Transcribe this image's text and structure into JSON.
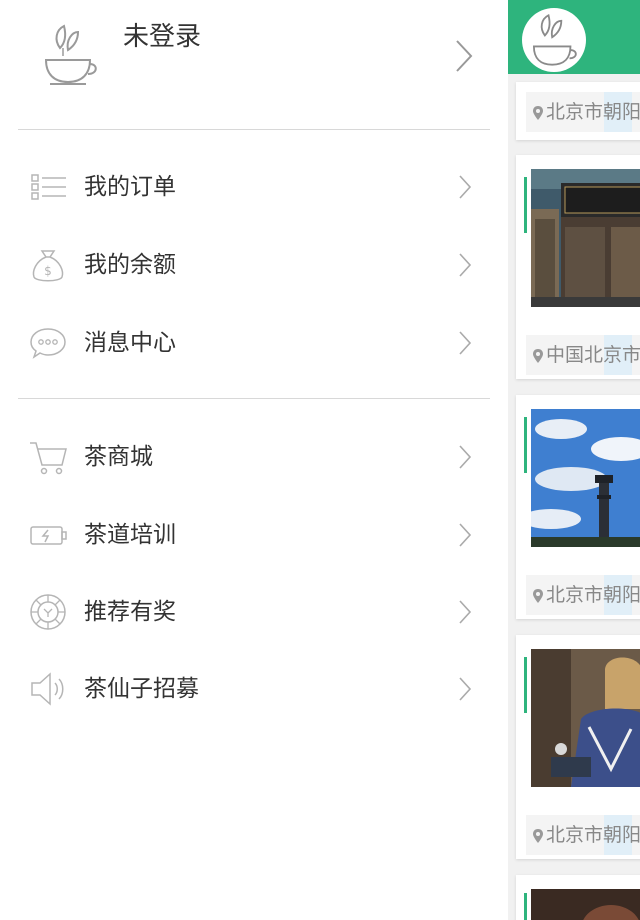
{
  "drawer": {
    "profile": {
      "name": "未登录",
      "avatar_icon": "tea-cup-icon"
    },
    "group1": [
      {
        "label": "我的订单",
        "icon": "list-icon"
      },
      {
        "label": "我的余额",
        "icon": "money-bag-icon"
      },
      {
        "label": "消息中心",
        "icon": "chat-bubble-icon"
      }
    ],
    "group2": [
      {
        "label": "茶商城",
        "icon": "cart-icon"
      },
      {
        "label": "茶道培训",
        "icon": "battery-icon"
      },
      {
        "label": "推荐有奖",
        "icon": "coin-icon"
      },
      {
        "label": "茶仙子招募",
        "icon": "speaker-icon"
      }
    ]
  },
  "feed": {
    "accent_color": "#2eb47d",
    "cards": [
      {
        "location": "北京市朝阳区"
      },
      {
        "location": "中国北京市"
      },
      {
        "location": "北京市朝阳区"
      },
      {
        "location": "北京市朝阳区"
      }
    ]
  }
}
